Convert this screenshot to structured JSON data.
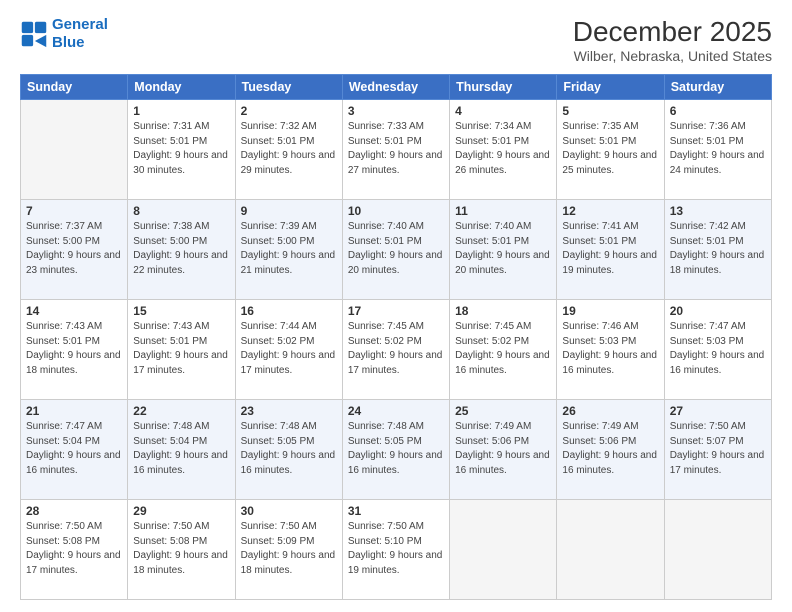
{
  "header": {
    "logo_line1": "General",
    "logo_line2": "Blue",
    "month": "December 2025",
    "location": "Wilber, Nebraska, United States"
  },
  "days_of_week": [
    "Sunday",
    "Monday",
    "Tuesday",
    "Wednesday",
    "Thursday",
    "Friday",
    "Saturday"
  ],
  "weeks": [
    [
      {
        "num": "",
        "empty": true
      },
      {
        "num": "1",
        "rise": "7:31 AM",
        "set": "5:01 PM",
        "daylight": "9 hours and 30 minutes."
      },
      {
        "num": "2",
        "rise": "7:32 AM",
        "set": "5:01 PM",
        "daylight": "9 hours and 29 minutes."
      },
      {
        "num": "3",
        "rise": "7:33 AM",
        "set": "5:01 PM",
        "daylight": "9 hours and 27 minutes."
      },
      {
        "num": "4",
        "rise": "7:34 AM",
        "set": "5:01 PM",
        "daylight": "9 hours and 26 minutes."
      },
      {
        "num": "5",
        "rise": "7:35 AM",
        "set": "5:01 PM",
        "daylight": "9 hours and 25 minutes."
      },
      {
        "num": "6",
        "rise": "7:36 AM",
        "set": "5:01 PM",
        "daylight": "9 hours and 24 minutes."
      }
    ],
    [
      {
        "num": "7",
        "rise": "7:37 AM",
        "set": "5:00 PM",
        "daylight": "9 hours and 23 minutes."
      },
      {
        "num": "8",
        "rise": "7:38 AM",
        "set": "5:00 PM",
        "daylight": "9 hours and 22 minutes."
      },
      {
        "num": "9",
        "rise": "7:39 AM",
        "set": "5:00 PM",
        "daylight": "9 hours and 21 minutes."
      },
      {
        "num": "10",
        "rise": "7:40 AM",
        "set": "5:01 PM",
        "daylight": "9 hours and 20 minutes."
      },
      {
        "num": "11",
        "rise": "7:40 AM",
        "set": "5:01 PM",
        "daylight": "9 hours and 20 minutes."
      },
      {
        "num": "12",
        "rise": "7:41 AM",
        "set": "5:01 PM",
        "daylight": "9 hours and 19 minutes."
      },
      {
        "num": "13",
        "rise": "7:42 AM",
        "set": "5:01 PM",
        "daylight": "9 hours and 18 minutes."
      }
    ],
    [
      {
        "num": "14",
        "rise": "7:43 AM",
        "set": "5:01 PM",
        "daylight": "9 hours and 18 minutes."
      },
      {
        "num": "15",
        "rise": "7:43 AM",
        "set": "5:01 PM",
        "daylight": "9 hours and 17 minutes."
      },
      {
        "num": "16",
        "rise": "7:44 AM",
        "set": "5:02 PM",
        "daylight": "9 hours and 17 minutes."
      },
      {
        "num": "17",
        "rise": "7:45 AM",
        "set": "5:02 PM",
        "daylight": "9 hours and 17 minutes."
      },
      {
        "num": "18",
        "rise": "7:45 AM",
        "set": "5:02 PM",
        "daylight": "9 hours and 16 minutes."
      },
      {
        "num": "19",
        "rise": "7:46 AM",
        "set": "5:03 PM",
        "daylight": "9 hours and 16 minutes."
      },
      {
        "num": "20",
        "rise": "7:47 AM",
        "set": "5:03 PM",
        "daylight": "9 hours and 16 minutes."
      }
    ],
    [
      {
        "num": "21",
        "rise": "7:47 AM",
        "set": "5:04 PM",
        "daylight": "9 hours and 16 minutes."
      },
      {
        "num": "22",
        "rise": "7:48 AM",
        "set": "5:04 PM",
        "daylight": "9 hours and 16 minutes."
      },
      {
        "num": "23",
        "rise": "7:48 AM",
        "set": "5:05 PM",
        "daylight": "9 hours and 16 minutes."
      },
      {
        "num": "24",
        "rise": "7:48 AM",
        "set": "5:05 PM",
        "daylight": "9 hours and 16 minutes."
      },
      {
        "num": "25",
        "rise": "7:49 AM",
        "set": "5:06 PM",
        "daylight": "9 hours and 16 minutes."
      },
      {
        "num": "26",
        "rise": "7:49 AM",
        "set": "5:06 PM",
        "daylight": "9 hours and 16 minutes."
      },
      {
        "num": "27",
        "rise": "7:50 AM",
        "set": "5:07 PM",
        "daylight": "9 hours and 17 minutes."
      }
    ],
    [
      {
        "num": "28",
        "rise": "7:50 AM",
        "set": "5:08 PM",
        "daylight": "9 hours and 17 minutes."
      },
      {
        "num": "29",
        "rise": "7:50 AM",
        "set": "5:08 PM",
        "daylight": "9 hours and 18 minutes."
      },
      {
        "num": "30",
        "rise": "7:50 AM",
        "set": "5:09 PM",
        "daylight": "9 hours and 18 minutes."
      },
      {
        "num": "31",
        "rise": "7:50 AM",
        "set": "5:10 PM",
        "daylight": "9 hours and 19 minutes."
      },
      {
        "num": "",
        "empty": true
      },
      {
        "num": "",
        "empty": true
      },
      {
        "num": "",
        "empty": true
      }
    ]
  ]
}
